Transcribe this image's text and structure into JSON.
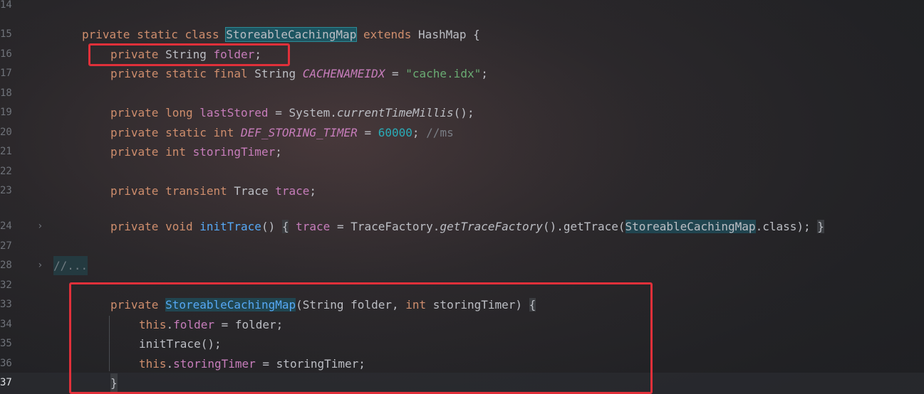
{
  "lines": [
    {
      "num": "14"
    },
    {
      "num": "15",
      "tokens": [
        "private static class",
        "StoreableCachingMap",
        "extends",
        "HashMap {"
      ]
    },
    {
      "num": "16",
      "tokens": [
        "private",
        "String",
        "folder",
        ";"
      ]
    },
    {
      "num": "17",
      "tokens": [
        "private static final",
        "String",
        "CACHENAMEIDX",
        "=",
        "\"cache.idx\"",
        ";"
      ]
    },
    {
      "num": "18"
    },
    {
      "num": "19",
      "tokens": [
        "private long",
        "lastStored",
        "= System.",
        "currentTimeMillis",
        "();"
      ]
    },
    {
      "num": "20",
      "tokens": [
        "private static int",
        "DEF_STORING_TIMER",
        "=",
        "60000",
        ";",
        "//ms"
      ]
    },
    {
      "num": "21",
      "tokens": [
        "private int",
        "storingTimer",
        ";"
      ]
    },
    {
      "num": "22"
    },
    {
      "num": "23",
      "tokens": [
        "private transient",
        "Trace",
        "trace",
        ";"
      ]
    },
    {
      "num": "24",
      "tokens": [
        "private void",
        "initTrace",
        "()",
        "{",
        "trace",
        "= TraceFactory.",
        "getTraceFactory",
        "().getTrace(",
        "StoreableCachingMap",
        ".class);",
        "}"
      ]
    },
    {
      "num": "27"
    },
    {
      "num": "28",
      "tokens": [
        "//..."
      ]
    },
    {
      "num": "32"
    },
    {
      "num": "33",
      "tokens": [
        "private",
        "StoreableCachingMap",
        "(String folder,",
        "int",
        "storingTimer)",
        "{"
      ]
    },
    {
      "num": "34",
      "tokens": [
        "this",
        ".",
        "folder",
        "= folder;"
      ]
    },
    {
      "num": "35",
      "tokens": [
        "initTrace();"
      ]
    },
    {
      "num": "36",
      "tokens": [
        "this",
        ".",
        "storingTimer",
        "= storingTimer;"
      ]
    },
    {
      "num": "37",
      "tokens": [
        "}"
      ]
    }
  ],
  "fold_arrow": "›",
  "colors": {
    "keyword": "#cf8e6d",
    "field": "#c77dbb",
    "string": "#6aab73",
    "number": "#2aacb8",
    "method": "#56a8f5",
    "highlight_box": "#e0303a"
  }
}
